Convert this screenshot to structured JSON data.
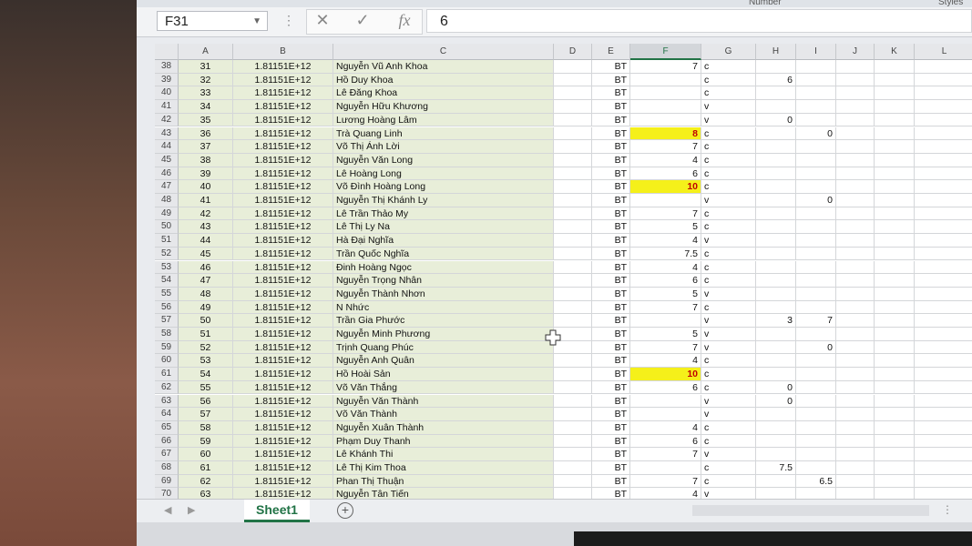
{
  "ribbon": {
    "number_label": "Number",
    "styles_label": "Styles"
  },
  "formula_bar": {
    "name_box": "F31",
    "cancel_icon": "✕",
    "enter_icon": "✓",
    "fx_label": "fx",
    "value": "6"
  },
  "columns": [
    "A",
    "B",
    "C",
    "D",
    "E",
    "F",
    "G",
    "H",
    "I",
    "J",
    "K",
    "L"
  ],
  "rows": [
    {
      "r": "38",
      "a": "31",
      "b": "1.81151E+12",
      "c": "Nguyễn Vũ Anh Khoa",
      "e": "BT",
      "f": "7",
      "g": "c",
      "h": "",
      "i": ""
    },
    {
      "r": "39",
      "a": "32",
      "b": "1.81151E+12",
      "c": "Hồ Duy Khoa",
      "e": "BT",
      "f": "",
      "g": "c",
      "h": "6",
      "i": ""
    },
    {
      "r": "40",
      "a": "33",
      "b": "1.81151E+12",
      "c": "Lê Đăng Khoa",
      "e": "BT",
      "f": "",
      "g": "c",
      "h": "",
      "i": ""
    },
    {
      "r": "41",
      "a": "34",
      "b": "1.81151E+12",
      "c": "Nguyễn Hữu Khương",
      "e": "BT",
      "f": "",
      "g": "v",
      "h": "",
      "i": ""
    },
    {
      "r": "42",
      "a": "35",
      "b": "1.81151E+12",
      "c": "Lương Hoàng Lâm",
      "e": "BT",
      "f": "",
      "g": "v",
      "h": "0",
      "i": ""
    },
    {
      "r": "43",
      "a": "36",
      "b": "1.81151E+12",
      "c": "Trà Quang Linh",
      "e": "BT",
      "f": "8",
      "g": "c",
      "h": "",
      "i": "0",
      "yellow": true
    },
    {
      "r": "44",
      "a": "37",
      "b": "1.81151E+12",
      "c": "Võ Thị Ánh Lời",
      "e": "BT",
      "f": "7",
      "g": "c",
      "h": "",
      "i": ""
    },
    {
      "r": "45",
      "a": "38",
      "b": "1.81151E+12",
      "c": "Nguyễn Văn Long",
      "e": "BT",
      "f": "4",
      "g": "c",
      "h": "",
      "i": ""
    },
    {
      "r": "46",
      "a": "39",
      "b": "1.81151E+12",
      "c": "Lê Hoàng Long",
      "e": "BT",
      "f": "6",
      "g": "c",
      "h": "",
      "i": ""
    },
    {
      "r": "47",
      "a": "40",
      "b": "1.81151E+12",
      "c": "Võ Đình Hoàng Long",
      "e": "BT",
      "f": "10",
      "g": "c",
      "h": "",
      "i": "",
      "yellow": true
    },
    {
      "r": "48",
      "a": "41",
      "b": "1.81151E+12",
      "c": "Nguyễn Thị Khánh Ly",
      "e": "BT",
      "f": "",
      "g": "v",
      "h": "",
      "i": "0"
    },
    {
      "r": "49",
      "a": "42",
      "b": "1.81151E+12",
      "c": "Lê Trần Thảo My",
      "e": "BT",
      "f": "7",
      "g": "c",
      "h": "",
      "i": ""
    },
    {
      "r": "50",
      "a": "43",
      "b": "1.81151E+12",
      "c": "Lê Thị Ly Na",
      "e": "BT",
      "f": "5",
      "g": "c",
      "h": "",
      "i": ""
    },
    {
      "r": "51",
      "a": "44",
      "b": "1.81151E+12",
      "c": "Hà Đại Nghĩa",
      "e": "BT",
      "f": "4",
      "g": "v",
      "h": "",
      "i": ""
    },
    {
      "r": "52",
      "a": "45",
      "b": "1.81151E+12",
      "c": "Trần Quốc Nghĩa",
      "e": "BT",
      "f": "7.5",
      "g": "c",
      "h": "",
      "i": ""
    },
    {
      "r": "53",
      "a": "46",
      "b": "1.81151E+12",
      "c": "Đinh Hoàng Ngọc",
      "e": "BT",
      "f": "4",
      "g": "c",
      "h": "",
      "i": ""
    },
    {
      "r": "54",
      "a": "47",
      "b": "1.81151E+12",
      "c": "Nguyễn Trọng Nhân",
      "e": "BT",
      "f": "6",
      "g": "c",
      "h": "",
      "i": ""
    },
    {
      "r": "55",
      "a": "48",
      "b": "1.81151E+12",
      "c": "Nguyễn Thành Nhơn",
      "e": "BT",
      "f": "5",
      "g": "v",
      "h": "",
      "i": ""
    },
    {
      "r": "56",
      "a": "49",
      "b": "1.81151E+12",
      "c": "N Nhức",
      "e": "BT",
      "f": "7",
      "g": "c",
      "h": "",
      "i": ""
    },
    {
      "r": "57",
      "a": "50",
      "b": "1.81151E+12",
      "c": "Trần Gia Phước",
      "e": "BT",
      "f": "",
      "g": "v",
      "h": "3",
      "i": "7"
    },
    {
      "r": "58",
      "a": "51",
      "b": "1.81151E+12",
      "c": "Nguyễn Minh Phương",
      "e": "BT",
      "f": "5",
      "g": "v",
      "h": "",
      "i": ""
    },
    {
      "r": "59",
      "a": "52",
      "b": "1.81151E+12",
      "c": "Trịnh Quang Phúc",
      "e": "BT",
      "f": "7",
      "g": "v",
      "h": "",
      "i": "0"
    },
    {
      "r": "60",
      "a": "53",
      "b": "1.81151E+12",
      "c": "Nguyễn Anh Quân",
      "e": "BT",
      "f": "4",
      "g": "c",
      "h": "",
      "i": ""
    },
    {
      "r": "61",
      "a": "54",
      "b": "1.81151E+12",
      "c": "Hồ Hoài Sản",
      "e": "BT",
      "f": "10",
      "g": "c",
      "h": "",
      "i": "",
      "yellow": true
    },
    {
      "r": "62",
      "a": "55",
      "b": "1.81151E+12",
      "c": "Võ Văn Thắng",
      "e": "BT",
      "f": "6",
      "g": "c",
      "h": "0",
      "i": ""
    },
    {
      "r": "63",
      "a": "56",
      "b": "1.81151E+12",
      "c": "Nguyễn Văn Thành",
      "e": "BT",
      "f": "",
      "g": "v",
      "h": "0",
      "i": ""
    },
    {
      "r": "64",
      "a": "57",
      "b": "1.81151E+12",
      "c": "Võ Văn Thành",
      "e": "BT",
      "f": "",
      "g": "v",
      "h": "",
      "i": ""
    },
    {
      "r": "65",
      "a": "58",
      "b": "1.81151E+12",
      "c": "Nguyễn Xuân Thành",
      "e": "BT",
      "f": "4",
      "g": "c",
      "h": "",
      "i": ""
    },
    {
      "r": "66",
      "a": "59",
      "b": "1.81151E+12",
      "c": "Phạm Duy Thanh",
      "e": "BT",
      "f": "6",
      "g": "c",
      "h": "",
      "i": ""
    },
    {
      "r": "67",
      "a": "60",
      "b": "1.81151E+12",
      "c": "Lê Khánh Thi",
      "e": "BT",
      "f": "7",
      "g": "v",
      "h": "",
      "i": ""
    },
    {
      "r": "68",
      "a": "61",
      "b": "1.81151E+12",
      "c": "Lê Thị Kim Thoa",
      "e": "BT",
      "f": "",
      "g": "c",
      "h": "7.5",
      "i": ""
    },
    {
      "r": "69",
      "a": "62",
      "b": "1.81151E+12",
      "c": "Phan Thị Thuận",
      "e": "BT",
      "f": "7",
      "g": "c",
      "h": "",
      "i": "6.5"
    },
    {
      "r": "70",
      "a": "63",
      "b": "1.81151E+12",
      "c": "Nguyễn Tân Tiến",
      "e": "BT",
      "f": "4",
      "g": "v",
      "h": "",
      "i": ""
    }
  ],
  "sheet_tab": {
    "name": "Sheet1",
    "add_icon": "+"
  }
}
